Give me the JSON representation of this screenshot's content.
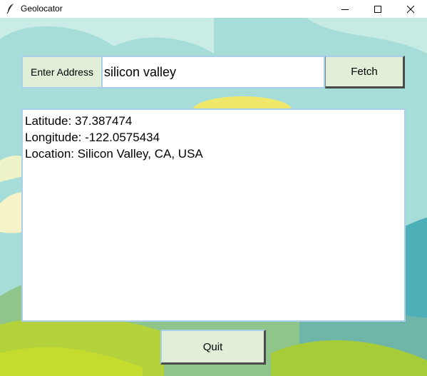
{
  "window": {
    "title": "Geolocator",
    "controls": {
      "minimize_icon": "minimize-icon",
      "maximize_icon": "maximize-icon",
      "close_icon": "close-icon"
    }
  },
  "form": {
    "label": "Enter Address",
    "address_value": "silicon valley",
    "fetch_label": "Fetch"
  },
  "result": {
    "lines": [
      "Latitude: 37.387474",
      "Longitude: -122.0575434",
      "Location: Silicon Valley, CA, USA"
    ]
  },
  "footer": {
    "quit_label": "Quit"
  },
  "colors": {
    "button_bg": "#e1efd9",
    "border": "#a8d0ea",
    "sky": "#a6ddd8"
  }
}
